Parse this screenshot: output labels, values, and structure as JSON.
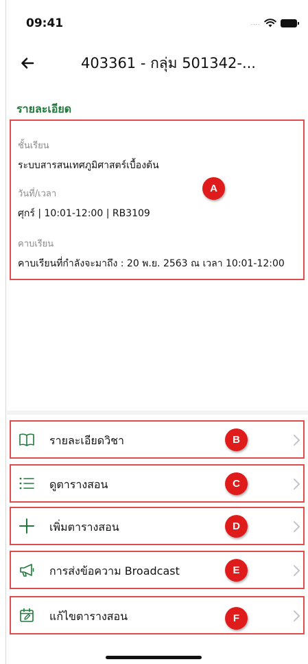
{
  "status_bar": {
    "time": "09:41",
    "signal": "....",
    "icons": [
      "wifi-icon",
      "battery-icon"
    ]
  },
  "nav": {
    "title": "403361 - กลุ่ม 501342-...",
    "back_icon": "back-arrow-icon"
  },
  "details": {
    "heading": "รายละเอียด",
    "fields": [
      {
        "label": "ชั้นเรียน",
        "value": "ระบบสารสนเทศภูมิศาสตร์เบื้องต้น"
      },
      {
        "label": "วันที่/เวลา",
        "value": "ศุกร์  |  10:01-12:00  |  RB3109"
      },
      {
        "label": "คาบเรียน",
        "value": "คาบเรียนที่กำลังจะมาถึง : 20 พ.ย. 2563 ณ เวลา 10:01-12:00"
      }
    ],
    "badge": "A"
  },
  "menu": [
    {
      "label": "รายละเอียดวิชา",
      "icon": "book-open-icon",
      "badge": "B"
    },
    {
      "label": "ดูตารางสอน",
      "icon": "list-icon",
      "badge": "C"
    },
    {
      "label": "เพิ่มตารางสอน",
      "icon": "plus-icon",
      "badge": "D"
    },
    {
      "label": "การส่งข้อความ Broadcast",
      "icon": "megaphone-icon",
      "badge": "E"
    },
    {
      "label": "แก้ไขตารางสอน",
      "icon": "calendar-edit-icon",
      "badge": "F"
    }
  ],
  "colors": {
    "accent": "#1d7a3a",
    "annotation": "#e24b4b",
    "badge": "#e01b1b"
  }
}
